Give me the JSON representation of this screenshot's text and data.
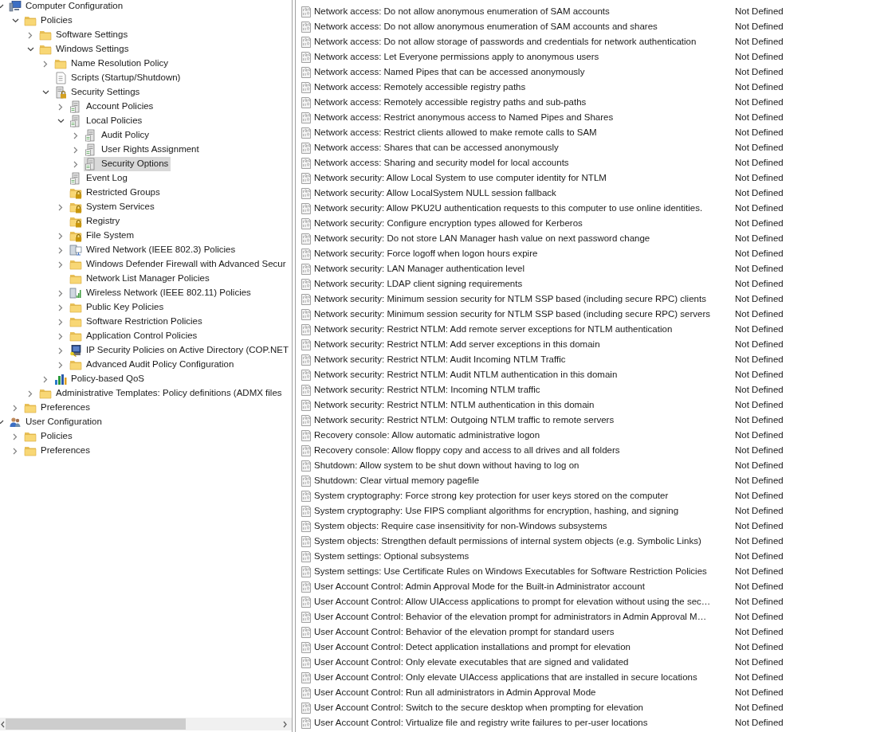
{
  "tree": [
    {
      "label": "Computer Configuration",
      "kind": "computer",
      "expanded": true,
      "selected": false,
      "children": [
        {
          "label": "Policies",
          "kind": "folder",
          "expanded": true,
          "selected": false,
          "children": [
            {
              "label": "Software Settings",
              "kind": "folder",
              "expanded": false,
              "selected": false
            },
            {
              "label": "Windows Settings",
              "kind": "folder",
              "expanded": true,
              "selected": false,
              "children": [
                {
                  "label": "Name Resolution Policy",
                  "kind": "folder",
                  "expanded": false,
                  "selected": false
                },
                {
                  "label": "Scripts (Startup/Shutdown)",
                  "kind": "script",
                  "selected": false
                },
                {
                  "label": "Security Settings",
                  "kind": "security",
                  "expanded": true,
                  "selected": false,
                  "children": [
                    {
                      "label": "Account Policies",
                      "kind": "policy",
                      "expanded": false,
                      "selected": false
                    },
                    {
                      "label": "Local Policies",
                      "kind": "policy",
                      "expanded": true,
                      "selected": false,
                      "children": [
                        {
                          "label": "Audit Policy",
                          "kind": "policy",
                          "expanded": false,
                          "selected": false
                        },
                        {
                          "label": "User Rights Assignment",
                          "kind": "policy",
                          "expanded": false,
                          "selected": false
                        },
                        {
                          "label": "Security Options",
                          "kind": "policy",
                          "expanded": false,
                          "selected": true
                        }
                      ]
                    },
                    {
                      "label": "Event Log",
                      "kind": "policy",
                      "selected": false
                    },
                    {
                      "label": "Restricted Groups",
                      "kind": "lockfolder",
                      "selected": false
                    },
                    {
                      "label": "System Services",
                      "kind": "lockfolder",
                      "expanded": false,
                      "selected": false
                    },
                    {
                      "label": "Registry",
                      "kind": "lockfolder",
                      "selected": false
                    },
                    {
                      "label": "File System",
                      "kind": "lockfolder",
                      "expanded": false,
                      "selected": false
                    },
                    {
                      "label": "Wired Network (IEEE 802.3) Policies",
                      "kind": "wired",
                      "expanded": false,
                      "selected": false
                    },
                    {
                      "label": "Windows Defender Firewall with Advanced Secur",
                      "kind": "folder",
                      "expanded": false,
                      "selected": false
                    },
                    {
                      "label": "Network List Manager Policies",
                      "kind": "folder",
                      "selected": false
                    },
                    {
                      "label": "Wireless Network (IEEE 802.11) Policies",
                      "kind": "wireless",
                      "expanded": false,
                      "selected": false
                    },
                    {
                      "label": "Public Key Policies",
                      "kind": "folder",
                      "expanded": false,
                      "selected": false
                    },
                    {
                      "label": "Software Restriction Policies",
                      "kind": "folder",
                      "expanded": false,
                      "selected": false
                    },
                    {
                      "label": "Application Control Policies",
                      "kind": "folder",
                      "expanded": false,
                      "selected": false
                    },
                    {
                      "label": "IP Security Policies on Active Directory (COP.NET",
                      "kind": "ipsec",
                      "expanded": false,
                      "selected": false
                    },
                    {
                      "label": "Advanced Audit Policy Configuration",
                      "kind": "folder",
                      "expanded": false,
                      "selected": false
                    }
                  ]
                },
                {
                  "label": "Policy-based QoS",
                  "kind": "qos",
                  "expanded": false,
                  "selected": false
                }
              ]
            },
            {
              "label": "Administrative Templates: Policy definitions (ADMX files",
              "kind": "folder",
              "expanded": false,
              "selected": false
            }
          ]
        },
        {
          "label": "Preferences",
          "kind": "folder",
          "expanded": false,
          "selected": false
        }
      ]
    },
    {
      "label": "User Configuration",
      "kind": "user",
      "expanded": true,
      "selected": false,
      "children": [
        {
          "label": "Policies",
          "kind": "folder",
          "expanded": false,
          "selected": false
        },
        {
          "label": "Preferences",
          "kind": "folder",
          "expanded": false,
          "selected": false
        }
      ]
    }
  ],
  "policies": [
    {
      "name": "Network access: Do not allow anonymous enumeration of SAM accounts",
      "setting": "Not Defined"
    },
    {
      "name": "Network access: Do not allow anonymous enumeration of SAM accounts and shares",
      "setting": "Not Defined"
    },
    {
      "name": "Network access: Do not allow storage of passwords and credentials for network authentication",
      "setting": "Not Defined"
    },
    {
      "name": "Network access: Let Everyone permissions apply to anonymous users",
      "setting": "Not Defined"
    },
    {
      "name": "Network access: Named Pipes that can be accessed anonymously",
      "setting": "Not Defined"
    },
    {
      "name": "Network access: Remotely accessible registry paths",
      "setting": "Not Defined"
    },
    {
      "name": "Network access: Remotely accessible registry paths and sub-paths",
      "setting": "Not Defined"
    },
    {
      "name": "Network access: Restrict anonymous access to Named Pipes and Shares",
      "setting": "Not Defined"
    },
    {
      "name": "Network access: Restrict clients allowed to make remote calls to SAM",
      "setting": "Not Defined"
    },
    {
      "name": "Network access: Shares that can be accessed anonymously",
      "setting": "Not Defined"
    },
    {
      "name": "Network access: Sharing and security model for local accounts",
      "setting": "Not Defined"
    },
    {
      "name": "Network security: Allow Local System to use computer identity for NTLM",
      "setting": "Not Defined"
    },
    {
      "name": "Network security: Allow LocalSystem NULL session fallback",
      "setting": "Not Defined"
    },
    {
      "name": "Network security: Allow PKU2U authentication requests to this computer to use online identities.",
      "setting": "Not Defined"
    },
    {
      "name": "Network security: Configure encryption types allowed for Kerberos",
      "setting": "Not Defined"
    },
    {
      "name": "Network security: Do not store LAN Manager hash value on next password change",
      "setting": "Not Defined"
    },
    {
      "name": "Network security: Force logoff when logon hours expire",
      "setting": "Not Defined"
    },
    {
      "name": "Network security: LAN Manager authentication level",
      "setting": "Not Defined"
    },
    {
      "name": "Network security: LDAP client signing requirements",
      "setting": "Not Defined"
    },
    {
      "name": "Network security: Minimum session security for NTLM SSP based (including secure RPC) clients",
      "setting": "Not Defined"
    },
    {
      "name": "Network security: Minimum session security for NTLM SSP based (including secure RPC) servers",
      "setting": "Not Defined"
    },
    {
      "name": "Network security: Restrict NTLM: Add remote server exceptions for NTLM authentication",
      "setting": "Not Defined"
    },
    {
      "name": "Network security: Restrict NTLM: Add server exceptions in this domain",
      "setting": "Not Defined"
    },
    {
      "name": "Network security: Restrict NTLM: Audit Incoming NTLM Traffic",
      "setting": "Not Defined"
    },
    {
      "name": "Network security: Restrict NTLM: Audit NTLM authentication in this domain",
      "setting": "Not Defined"
    },
    {
      "name": "Network security: Restrict NTLM: Incoming NTLM traffic",
      "setting": "Not Defined"
    },
    {
      "name": "Network security: Restrict NTLM: NTLM authentication in this domain",
      "setting": "Not Defined"
    },
    {
      "name": "Network security: Restrict NTLM: Outgoing NTLM traffic to remote servers",
      "setting": "Not Defined"
    },
    {
      "name": "Recovery console: Allow automatic administrative logon",
      "setting": "Not Defined"
    },
    {
      "name": "Recovery console: Allow floppy copy and access to all drives and all folders",
      "setting": "Not Defined"
    },
    {
      "name": "Shutdown: Allow system to be shut down without having to log on",
      "setting": "Not Defined"
    },
    {
      "name": "Shutdown: Clear virtual memory pagefile",
      "setting": "Not Defined"
    },
    {
      "name": "System cryptography: Force strong key protection for user keys stored on the computer",
      "setting": "Not Defined"
    },
    {
      "name": "System cryptography: Use FIPS compliant algorithms for encryption, hashing, and signing",
      "setting": "Not Defined"
    },
    {
      "name": "System objects: Require case insensitivity for non-Windows subsystems",
      "setting": "Not Defined"
    },
    {
      "name": "System objects: Strengthen default permissions of internal system objects (e.g. Symbolic Links)",
      "setting": "Not Defined"
    },
    {
      "name": "System settings: Optional subsystems",
      "setting": "Not Defined"
    },
    {
      "name": "System settings: Use Certificate Rules on Windows Executables for Software Restriction Policies",
      "setting": "Not Defined"
    },
    {
      "name": "User Account Control: Admin Approval Mode for the Built-in Administrator account",
      "setting": "Not Defined"
    },
    {
      "name": "User Account Control: Allow UIAccess applications to prompt for elevation without using the sec…",
      "setting": "Not Defined"
    },
    {
      "name": "User Account Control: Behavior of the elevation prompt for administrators in Admin Approval M…",
      "setting": "Not Defined"
    },
    {
      "name": "User Account Control: Behavior of the elevation prompt for standard users",
      "setting": "Not Defined"
    },
    {
      "name": "User Account Control: Detect application installations and prompt for elevation",
      "setting": "Not Defined"
    },
    {
      "name": "User Account Control: Only elevate executables that are signed and validated",
      "setting": "Not Defined"
    },
    {
      "name": "User Account Control: Only elevate UIAccess applications that are installed in secure locations",
      "setting": "Not Defined"
    },
    {
      "name": "User Account Control: Run all administrators in Admin Approval Mode",
      "setting": "Not Defined"
    },
    {
      "name": "User Account Control: Switch to the secure desktop when prompting for elevation",
      "setting": "Not Defined"
    },
    {
      "name": "User Account Control: Virtualize file and registry write failures to per-user locations",
      "setting": "Not Defined"
    }
  ]
}
